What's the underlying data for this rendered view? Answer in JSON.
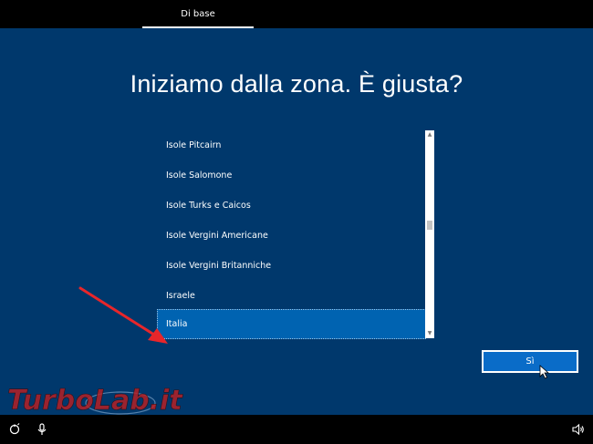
{
  "top_tab": {
    "label": "Di base"
  },
  "headline": "Iniziamo dalla zona. È giusta?",
  "region_list": {
    "items": [
      {
        "label": "Isole Pitcairn",
        "selected": false
      },
      {
        "label": "Isole Salomone",
        "selected": false
      },
      {
        "label": "Isole Turks e Caicos",
        "selected": false
      },
      {
        "label": "Isole Vergini Americane",
        "selected": false
      },
      {
        "label": "Isole Vergini Britanniche",
        "selected": false
      },
      {
        "label": "Israele",
        "selected": false
      },
      {
        "label": "Italia",
        "selected": true
      }
    ]
  },
  "primary_button": {
    "label": "Sì"
  },
  "watermark": {
    "text": "TurboLab.it"
  },
  "colors": {
    "background": "#00386c",
    "selection": "#0063b1",
    "button": "#0a6cc8",
    "arrow": "#e8262a",
    "bar": "#000000"
  },
  "icons": {
    "ease_of_access": "ease-of-access-icon",
    "microphone": "microphone-icon",
    "volume": "volume-icon"
  }
}
